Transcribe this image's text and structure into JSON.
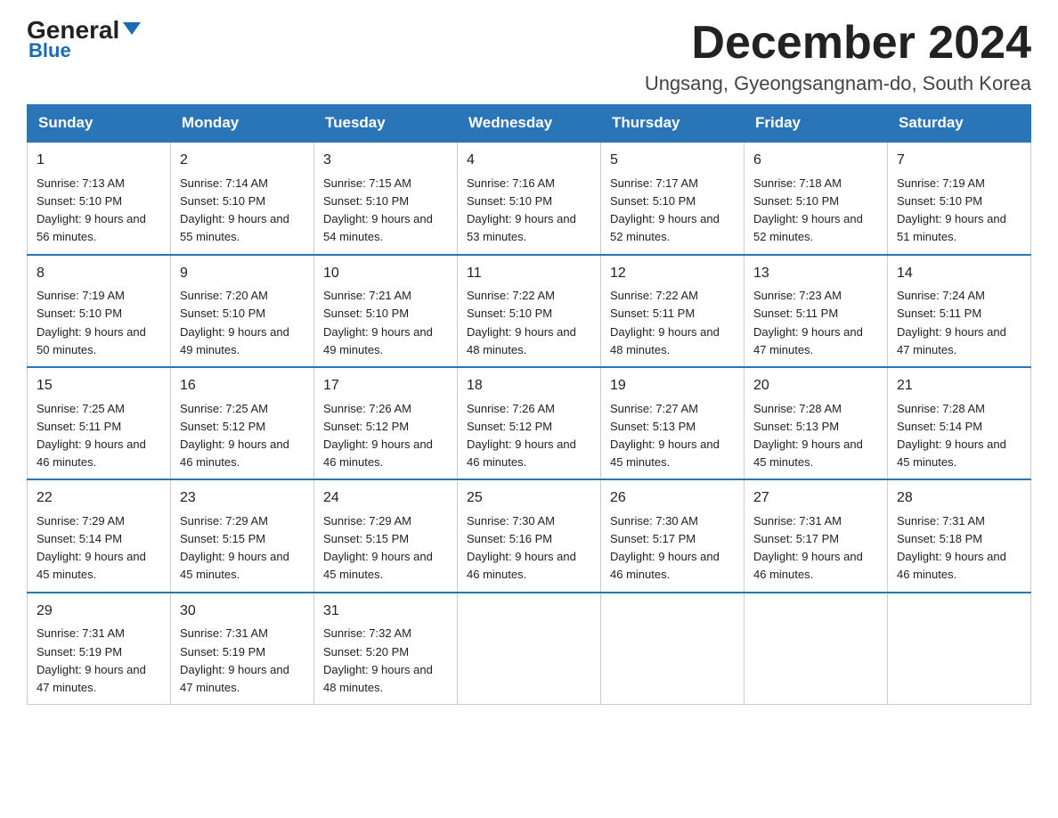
{
  "logo": {
    "general": "General",
    "triangle": "",
    "blue": "Blue"
  },
  "header": {
    "month": "December 2024",
    "location": "Ungsang, Gyeongsangnam-do, South Korea"
  },
  "days_of_week": [
    "Sunday",
    "Monday",
    "Tuesday",
    "Wednesday",
    "Thursday",
    "Friday",
    "Saturday"
  ],
  "weeks": [
    [
      {
        "day": "1",
        "sunrise": "7:13 AM",
        "sunset": "5:10 PM",
        "daylight": "9 hours and 56 minutes."
      },
      {
        "day": "2",
        "sunrise": "7:14 AM",
        "sunset": "5:10 PM",
        "daylight": "9 hours and 55 minutes."
      },
      {
        "day": "3",
        "sunrise": "7:15 AM",
        "sunset": "5:10 PM",
        "daylight": "9 hours and 54 minutes."
      },
      {
        "day": "4",
        "sunrise": "7:16 AM",
        "sunset": "5:10 PM",
        "daylight": "9 hours and 53 minutes."
      },
      {
        "day": "5",
        "sunrise": "7:17 AM",
        "sunset": "5:10 PM",
        "daylight": "9 hours and 52 minutes."
      },
      {
        "day": "6",
        "sunrise": "7:18 AM",
        "sunset": "5:10 PM",
        "daylight": "9 hours and 52 minutes."
      },
      {
        "day": "7",
        "sunrise": "7:19 AM",
        "sunset": "5:10 PM",
        "daylight": "9 hours and 51 minutes."
      }
    ],
    [
      {
        "day": "8",
        "sunrise": "7:19 AM",
        "sunset": "5:10 PM",
        "daylight": "9 hours and 50 minutes."
      },
      {
        "day": "9",
        "sunrise": "7:20 AM",
        "sunset": "5:10 PM",
        "daylight": "9 hours and 49 minutes."
      },
      {
        "day": "10",
        "sunrise": "7:21 AM",
        "sunset": "5:10 PM",
        "daylight": "9 hours and 49 minutes."
      },
      {
        "day": "11",
        "sunrise": "7:22 AM",
        "sunset": "5:10 PM",
        "daylight": "9 hours and 48 minutes."
      },
      {
        "day": "12",
        "sunrise": "7:22 AM",
        "sunset": "5:11 PM",
        "daylight": "9 hours and 48 minutes."
      },
      {
        "day": "13",
        "sunrise": "7:23 AM",
        "sunset": "5:11 PM",
        "daylight": "9 hours and 47 minutes."
      },
      {
        "day": "14",
        "sunrise": "7:24 AM",
        "sunset": "5:11 PM",
        "daylight": "9 hours and 47 minutes."
      }
    ],
    [
      {
        "day": "15",
        "sunrise": "7:25 AM",
        "sunset": "5:11 PM",
        "daylight": "9 hours and 46 minutes."
      },
      {
        "day": "16",
        "sunrise": "7:25 AM",
        "sunset": "5:12 PM",
        "daylight": "9 hours and 46 minutes."
      },
      {
        "day": "17",
        "sunrise": "7:26 AM",
        "sunset": "5:12 PM",
        "daylight": "9 hours and 46 minutes."
      },
      {
        "day": "18",
        "sunrise": "7:26 AM",
        "sunset": "5:12 PM",
        "daylight": "9 hours and 46 minutes."
      },
      {
        "day": "19",
        "sunrise": "7:27 AM",
        "sunset": "5:13 PM",
        "daylight": "9 hours and 45 minutes."
      },
      {
        "day": "20",
        "sunrise": "7:28 AM",
        "sunset": "5:13 PM",
        "daylight": "9 hours and 45 minutes."
      },
      {
        "day": "21",
        "sunrise": "7:28 AM",
        "sunset": "5:14 PM",
        "daylight": "9 hours and 45 minutes."
      }
    ],
    [
      {
        "day": "22",
        "sunrise": "7:29 AM",
        "sunset": "5:14 PM",
        "daylight": "9 hours and 45 minutes."
      },
      {
        "day": "23",
        "sunrise": "7:29 AM",
        "sunset": "5:15 PM",
        "daylight": "9 hours and 45 minutes."
      },
      {
        "day": "24",
        "sunrise": "7:29 AM",
        "sunset": "5:15 PM",
        "daylight": "9 hours and 45 minutes."
      },
      {
        "day": "25",
        "sunrise": "7:30 AM",
        "sunset": "5:16 PM",
        "daylight": "9 hours and 46 minutes."
      },
      {
        "day": "26",
        "sunrise": "7:30 AM",
        "sunset": "5:17 PM",
        "daylight": "9 hours and 46 minutes."
      },
      {
        "day": "27",
        "sunrise": "7:31 AM",
        "sunset": "5:17 PM",
        "daylight": "9 hours and 46 minutes."
      },
      {
        "day": "28",
        "sunrise": "7:31 AM",
        "sunset": "5:18 PM",
        "daylight": "9 hours and 46 minutes."
      }
    ],
    [
      {
        "day": "29",
        "sunrise": "7:31 AM",
        "sunset": "5:19 PM",
        "daylight": "9 hours and 47 minutes."
      },
      {
        "day": "30",
        "sunrise": "7:31 AM",
        "sunset": "5:19 PM",
        "daylight": "9 hours and 47 minutes."
      },
      {
        "day": "31",
        "sunrise": "7:32 AM",
        "sunset": "5:20 PM",
        "daylight": "9 hours and 48 minutes."
      },
      null,
      null,
      null,
      null
    ]
  ]
}
